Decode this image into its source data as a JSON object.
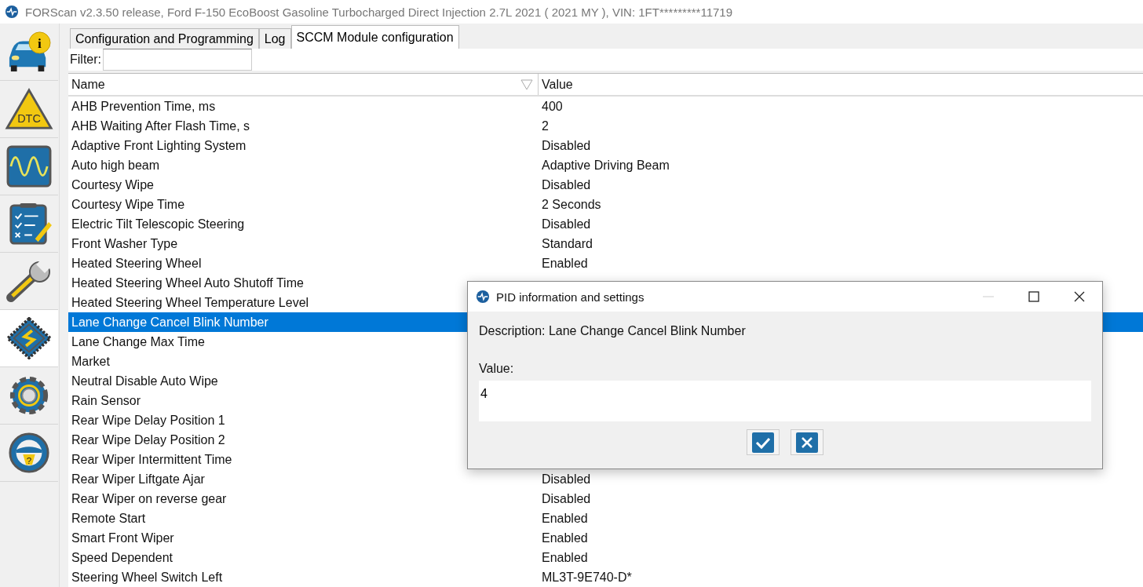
{
  "window": {
    "title": "FORScan v2.3.50 release, Ford F-150 EcoBoost Gasoline Turbocharged Direct Injection 2.7L 2021 ( 2021 MY ), VIN: 1FT*********11719"
  },
  "sidebar": {
    "items": [
      {
        "kind": "info",
        "label": "i",
        "selected": false
      },
      {
        "kind": "dtc",
        "label": "DTC",
        "selected": false
      },
      {
        "kind": "scope",
        "selected": false
      },
      {
        "kind": "checklist",
        "selected": false
      },
      {
        "kind": "wrench",
        "selected": false
      },
      {
        "kind": "chip",
        "selected": true
      },
      {
        "kind": "gear",
        "selected": false
      },
      {
        "kind": "help",
        "label": "?",
        "selected": false
      }
    ]
  },
  "tabs": [
    {
      "label": "Configuration and Programming",
      "selected": false
    },
    {
      "label": "Log",
      "selected": false
    },
    {
      "label": "SCCM Module configuration",
      "selected": true
    }
  ],
  "filter": {
    "label": "Filter:"
  },
  "table": {
    "columns": [
      "Name",
      "Value"
    ],
    "rows": [
      {
        "name": "AHB Prevention Time, ms",
        "value": "400",
        "selected": false
      },
      {
        "name": "AHB Waiting After Flash Time, s",
        "value": "2",
        "selected": false
      },
      {
        "name": "Adaptive Front Lighting System",
        "value": "Disabled",
        "selected": false
      },
      {
        "name": "Auto high beam",
        "value": "Adaptive Driving Beam",
        "selected": false
      },
      {
        "name": "Courtesy Wipe",
        "value": "Disabled",
        "selected": false
      },
      {
        "name": "Courtesy Wipe Time",
        "value": "2 Seconds",
        "selected": false
      },
      {
        "name": "Electric Tilt Telescopic Steering",
        "value": "Disabled",
        "selected": false
      },
      {
        "name": "Front Washer Type",
        "value": "Standard",
        "selected": false
      },
      {
        "name": "Heated Steering Wheel",
        "value": "Enabled",
        "selected": false
      },
      {
        "name": "Heated Steering Wheel Auto Shutoff Time",
        "selected": false
      },
      {
        "name": "Heated Steering Wheel Temperature Level",
        "selected": false
      },
      {
        "name": "Lane Change Cancel Blink Number",
        "selected": true
      },
      {
        "name": "Lane Change Max Time",
        "selected": false
      },
      {
        "name": "Market",
        "selected": false
      },
      {
        "name": "Neutral Disable Auto Wipe",
        "selected": false
      },
      {
        "name": "Rain Sensor",
        "selected": false
      },
      {
        "name": "Rear Wipe Delay Position 1",
        "selected": false
      },
      {
        "name": "Rear Wipe Delay Position 2",
        "selected": false
      },
      {
        "name": "Rear Wiper Intermittent Time",
        "selected": false
      },
      {
        "name": "Rear Wiper Liftgate Ajar",
        "value": "Disabled",
        "selected": false
      },
      {
        "name": "Rear Wiper on reverse gear",
        "value": "Disabled",
        "selected": false
      },
      {
        "name": "Remote Start",
        "value": "Enabled",
        "selected": false
      },
      {
        "name": "Smart Front Wiper",
        "value": "Enabled",
        "selected": false
      },
      {
        "name": "Speed Dependent",
        "value": "Enabled",
        "selected": false
      },
      {
        "name": "Steering Wheel Switch Left",
        "value": "ML3T-9E740-D*",
        "selected": false
      }
    ]
  },
  "dialog": {
    "title": "PID information and settings",
    "description": "Description: Lane Change Cancel Blink Number",
    "value_label": "Value:",
    "value": "4"
  }
}
